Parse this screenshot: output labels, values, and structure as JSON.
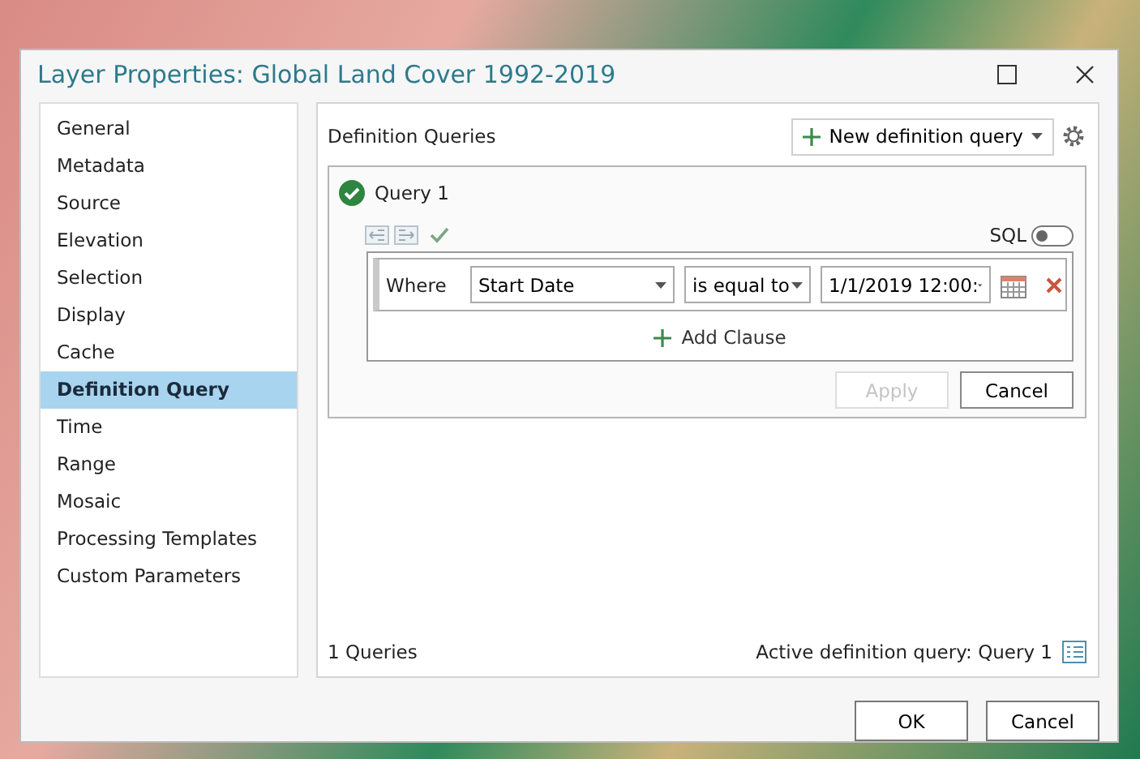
{
  "window": {
    "title": "Layer Properties: Global Land Cover 1992-2019"
  },
  "sidebar": {
    "items": [
      {
        "label": "General",
        "selected": false
      },
      {
        "label": "Metadata",
        "selected": false
      },
      {
        "label": "Source",
        "selected": false
      },
      {
        "label": "Elevation",
        "selected": false
      },
      {
        "label": "Selection",
        "selected": false
      },
      {
        "label": "Display",
        "selected": false
      },
      {
        "label": "Cache",
        "selected": false
      },
      {
        "label": "Definition Query",
        "selected": true
      },
      {
        "label": "Time",
        "selected": false
      },
      {
        "label": "Range",
        "selected": false
      },
      {
        "label": "Mosaic",
        "selected": false
      },
      {
        "label": "Processing Templates",
        "selected": false
      },
      {
        "label": "Custom Parameters",
        "selected": false
      }
    ]
  },
  "panel": {
    "title": "Definition Queries",
    "new_query_button": "New definition query",
    "query": {
      "name": "Query 1",
      "valid": true,
      "sql_label": "SQL",
      "sql_on": false,
      "clause": {
        "keyword": "Where",
        "field": "Start Date",
        "operator": "is equal to",
        "value": "1/1/2019 12:00:"
      },
      "add_clause": "Add Clause",
      "apply": {
        "label": "Apply",
        "disabled": true
      },
      "cancel": "Cancel"
    },
    "count": "1 Queries",
    "active_query": "Active definition query: Query 1"
  },
  "buttons": [
    "OK",
    "Cancel"
  ]
}
